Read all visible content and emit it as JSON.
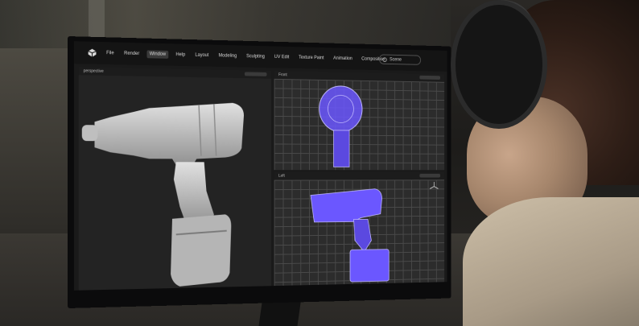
{
  "menu": {
    "items": [
      "File",
      "Render",
      "Window",
      "Help",
      "Layout",
      "Modeling",
      "Sculpting",
      "UV Edit",
      "Texture Paint",
      "Animation",
      "Composition"
    ],
    "active": "Window"
  },
  "scene_button": {
    "label": "Scene"
  },
  "viewports": {
    "perspective": {
      "label": "perspective"
    },
    "front": {
      "label": "Front"
    },
    "left": {
      "label": "Left"
    }
  },
  "colors": {
    "wireframe": "#6b57ff",
    "model": "#c9c9c9",
    "grid": "#4a4a4a"
  },
  "icons": [
    "app-logo-icon",
    "scene-icon",
    "axis-gizmo-icon"
  ]
}
